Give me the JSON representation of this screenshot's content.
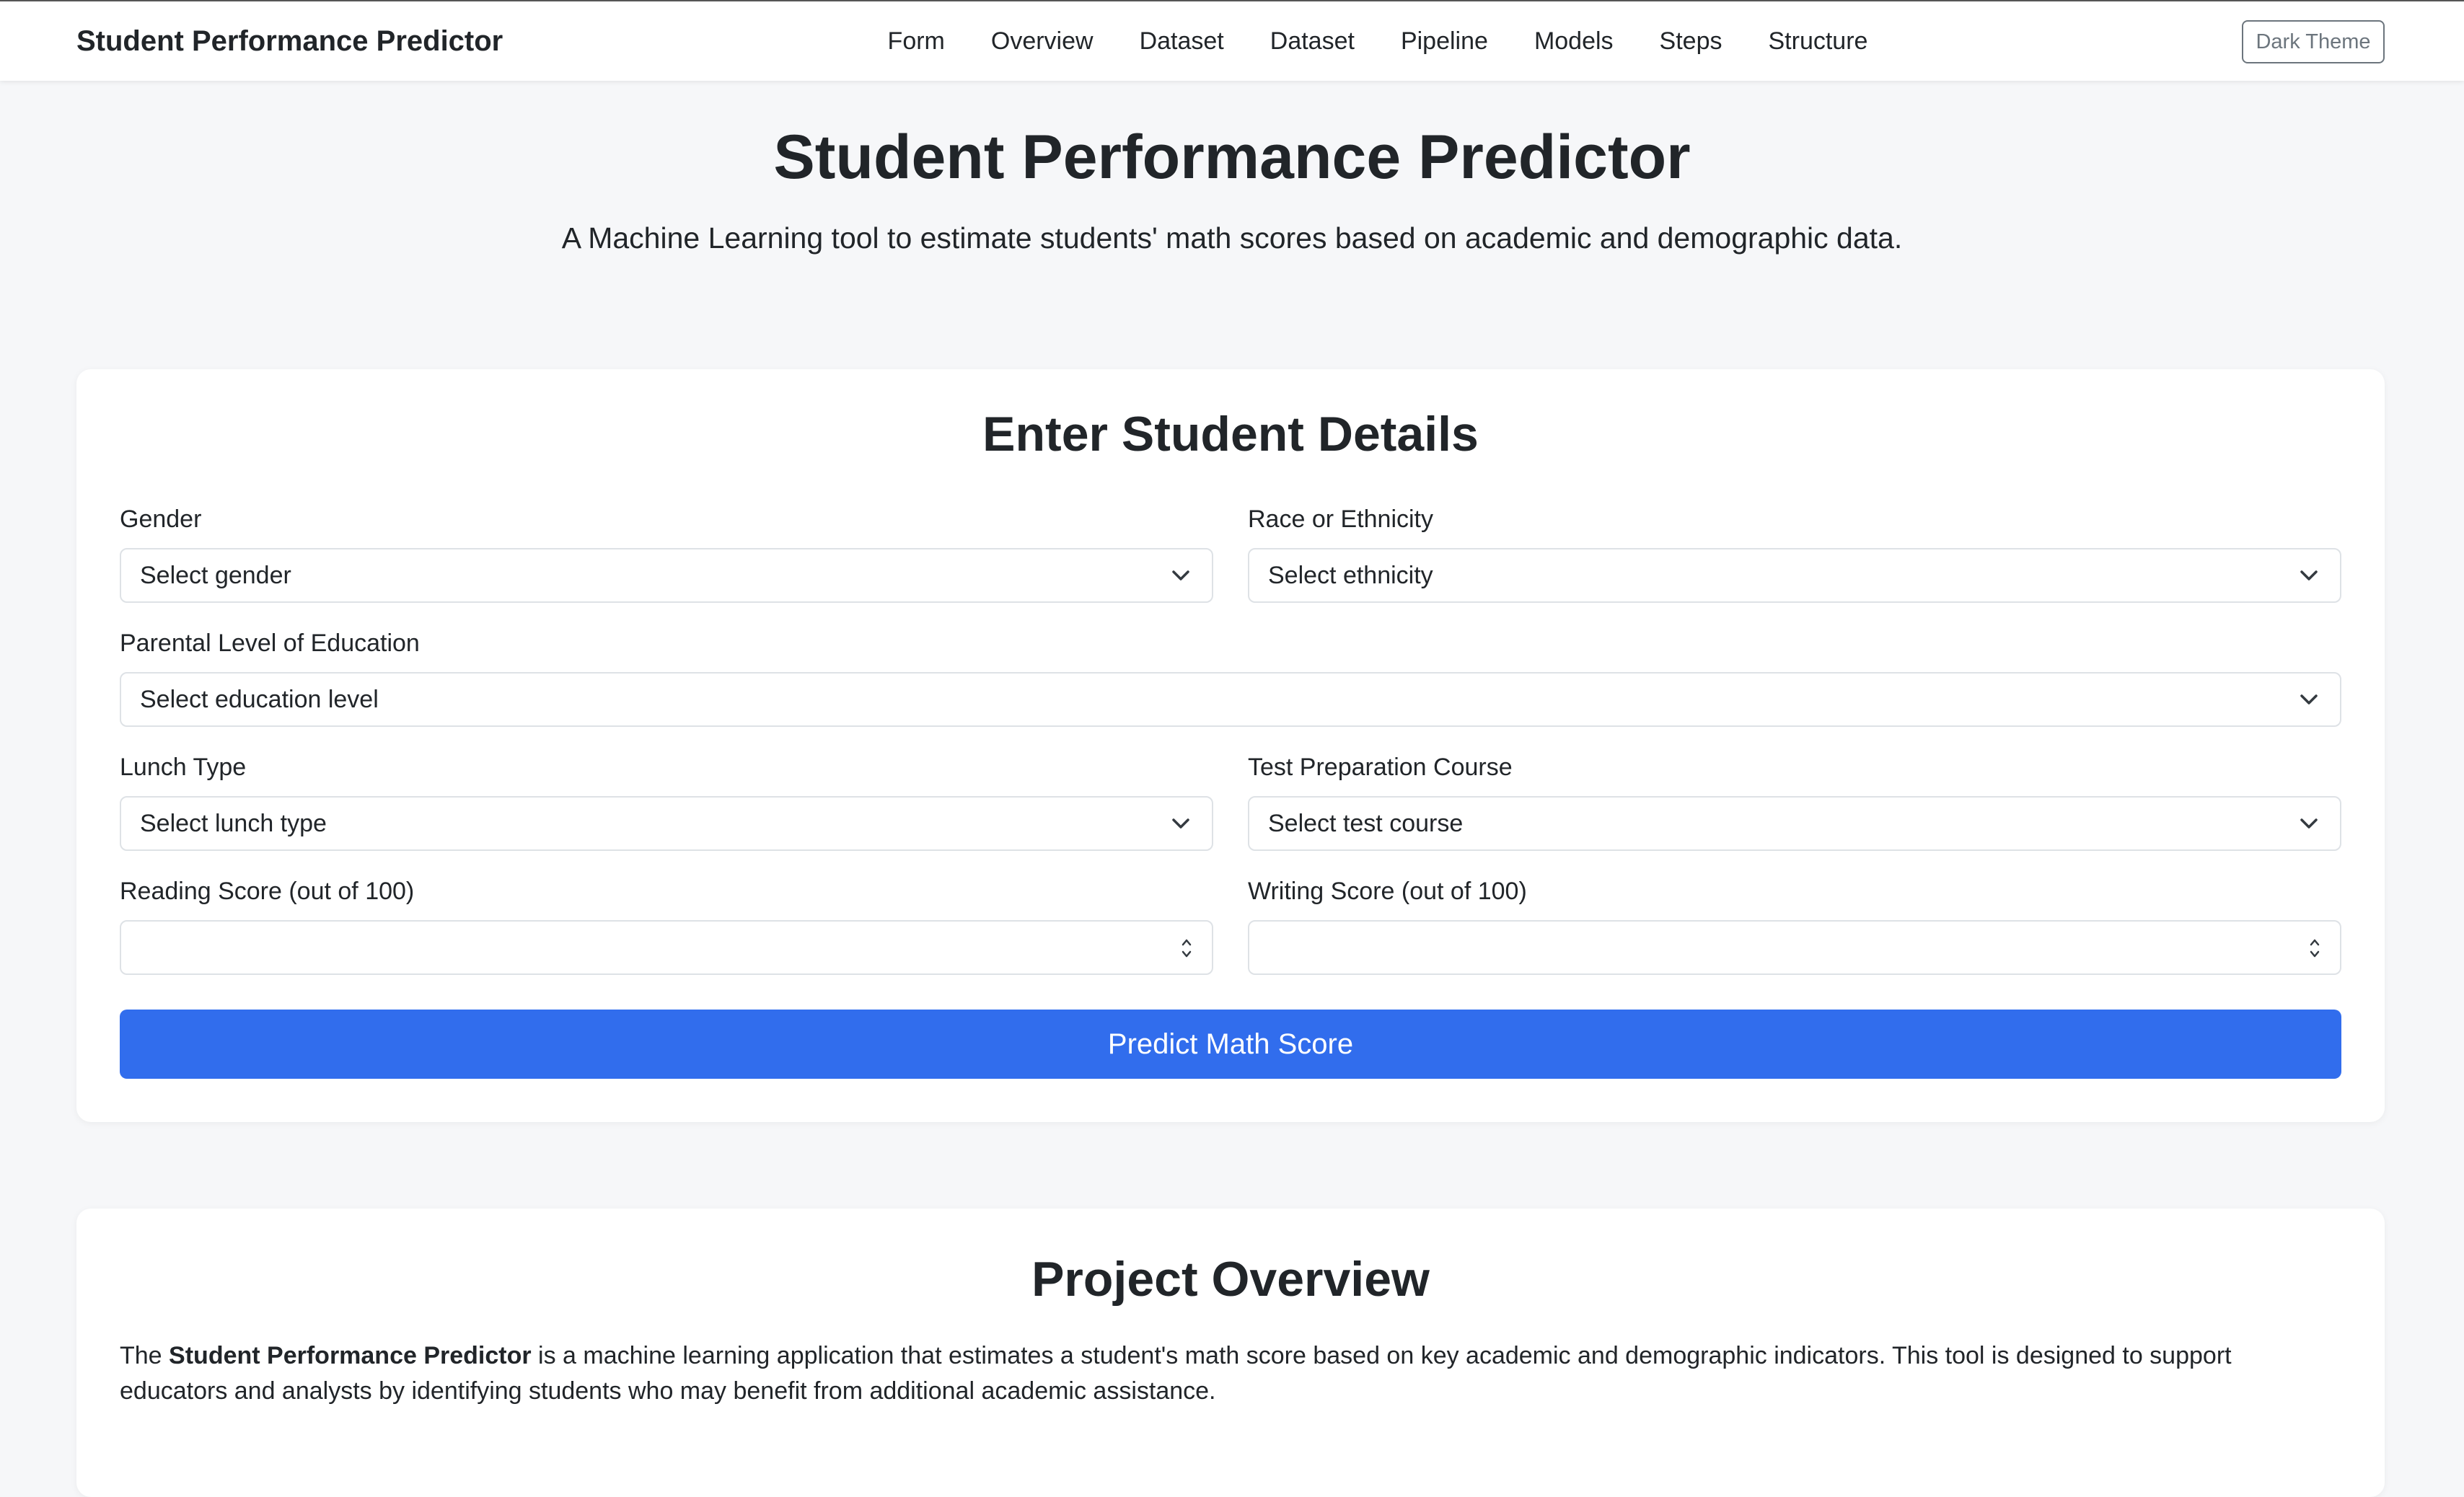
{
  "navbar": {
    "brand": "Student Performance Predictor",
    "links": [
      "Form",
      "Overview",
      "Dataset",
      "Dataset",
      "Pipeline",
      "Models",
      "Steps",
      "Structure"
    ],
    "theme_button": "Dark Theme"
  },
  "hero": {
    "title": "Student Performance Predictor",
    "subtitle": "A Machine Learning tool to estimate students' math scores based on academic and demographic data."
  },
  "form": {
    "title": "Enter Student Details",
    "gender": {
      "label": "Gender",
      "value": "Select gender"
    },
    "ethnicity": {
      "label": "Race or Ethnicity",
      "value": "Select ethnicity"
    },
    "education": {
      "label": "Parental Level of Education",
      "value": "Select education level"
    },
    "lunch": {
      "label": "Lunch Type",
      "value": "Select lunch type"
    },
    "test_prep": {
      "label": "Test Preparation Course",
      "value": "Select test course"
    },
    "reading": {
      "label": "Reading Score (out of 100)",
      "value": ""
    },
    "writing": {
      "label": "Writing Score (out of 100)",
      "value": ""
    },
    "submit": "Predict Math Score"
  },
  "overview": {
    "title": "Project Overview",
    "prefix": "The ",
    "bold": "Student Performance Predictor",
    "text": " is a machine learning application that estimates a student's math score based on key academic and demographic indicators. This tool is designed to support educators and analysts by identifying students who may benefit from additional academic assistance."
  },
  "colors": {
    "accent": "#316ded",
    "background": "#f6f7f9",
    "card": "#ffffff",
    "border": "#dee2e6"
  },
  "icons": {
    "select": "chevron-down-icon",
    "number": "spinner-icon"
  }
}
